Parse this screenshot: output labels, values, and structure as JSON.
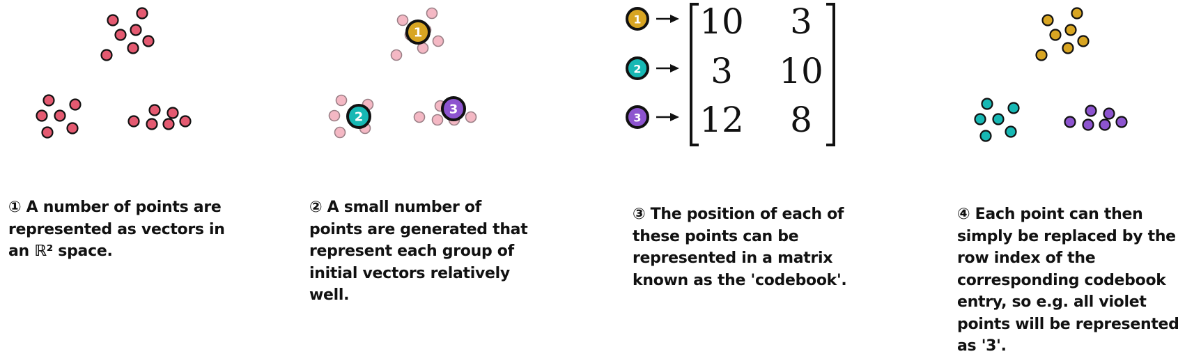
{
  "colors": {
    "point_red": "#e45a71",
    "point_faint": "#f4b8c4",
    "centroid_1": "#d8a522",
    "centroid_2": "#17b8b4",
    "centroid_3": "#8d54cf",
    "outline": "#111111"
  },
  "codebook": {
    "row_labels": [
      "1",
      "2",
      "3"
    ],
    "matrix": [
      [
        "10",
        "3"
      ],
      [
        "3",
        "10"
      ],
      [
        "12",
        "8"
      ]
    ]
  },
  "captions": {
    "step1": [
      "① A number of points are",
      "represented as vectors in",
      "an ℝ² space."
    ],
    "step2": [
      "② A small number of",
      "points are generated that",
      "represent each group of",
      "initial vectors relatively",
      "well."
    ],
    "step3": [
      "③ The position of each of",
      "these points can be",
      "represented in a matrix",
      "known as the 'codebook'."
    ],
    "step4": [
      "④ Each point can then",
      "simply be replaced by the",
      "row index of the",
      "corresponding codebook",
      "entry, so e.g. all violet",
      "points will be represented",
      "as '3'."
    ]
  }
}
